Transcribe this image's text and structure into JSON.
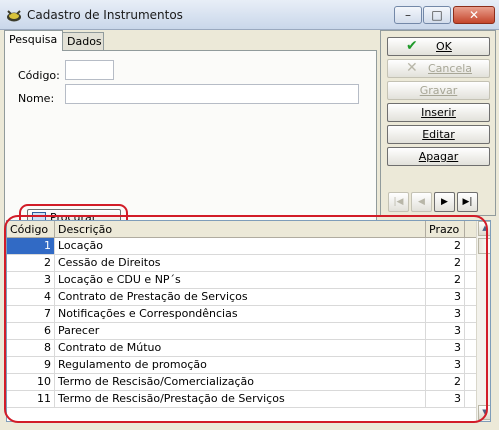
{
  "window": {
    "title": "Cadastro de Instrumentos",
    "minimize_glyph": "–",
    "maximize_glyph": "□",
    "close_glyph": "✕"
  },
  "tabs": [
    {
      "label": "Pesquisa",
      "active": true
    },
    {
      "label": "Dados",
      "active": false
    }
  ],
  "search": {
    "codigo_label": "Código:",
    "codigo_value": "",
    "nome_label": "Nome:",
    "nome_value": "",
    "procurar_label": "Procurar"
  },
  "actions": {
    "ok": "OK",
    "cancela": "Cancela",
    "gravar": "Gravar",
    "inserir": "Inserir",
    "editar": "Editar",
    "apagar": "Apagar"
  },
  "navigator": {
    "first_glyph": "|◀",
    "prior_glyph": "◀",
    "next_glyph": "▶",
    "last_glyph": "▶|"
  },
  "grid": {
    "columns": [
      "Código",
      "Descrição",
      "Prazo"
    ],
    "rows": [
      {
        "codigo": "1",
        "descricao": "Locação",
        "prazo": "2"
      },
      {
        "codigo": "2",
        "descricao": "Cessão de Direitos",
        "prazo": "2"
      },
      {
        "codigo": "3",
        "descricao": "Locação e CDU e NP´s",
        "prazo": "2"
      },
      {
        "codigo": "4",
        "descricao": "Contrato de Prestação de Serviços",
        "prazo": "3"
      },
      {
        "codigo": "7",
        "descricao": "Notificações e Correspondências",
        "prazo": "3"
      },
      {
        "codigo": "6",
        "descricao": "Parecer",
        "prazo": "3"
      },
      {
        "codigo": "8",
        "descricao": "Contrato de Mútuo",
        "prazo": "3"
      },
      {
        "codigo": "9",
        "descricao": "Regulamento de promoção",
        "prazo": "3"
      },
      {
        "codigo": "10",
        "descricao": "Termo de Rescisão/Comercialização",
        "prazo": "2"
      },
      {
        "codigo": "11",
        "descricao": "Termo de Rescisão/Prestação de Serviços",
        "prazo": "3"
      }
    ]
  },
  "colors": {
    "highlight_red": "#d21c28",
    "selection_blue": "#316ac5",
    "ok_check_green": "#1f9a2a"
  }
}
